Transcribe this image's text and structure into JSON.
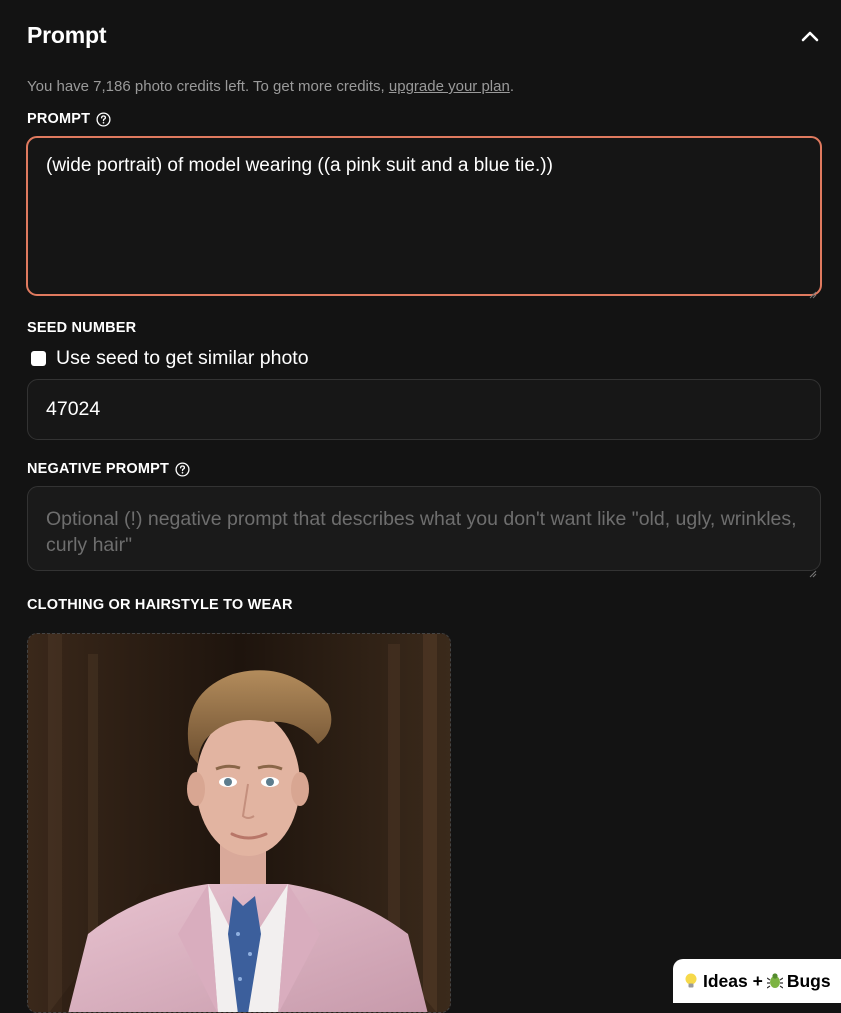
{
  "panel": {
    "title": "Prompt"
  },
  "credits": {
    "text": "You have 7,186 photo credits left. To get more credits, ",
    "link": "upgrade your plan",
    "suffix": "."
  },
  "prompt": {
    "label": "PROMPT",
    "value": "(wide portrait) of model wearing ((a pink suit and a blue tie.))"
  },
  "seed": {
    "label": "SEED NUMBER",
    "checkbox_label": "Use seed to get similar photo",
    "checked": false,
    "value": "47024"
  },
  "negative_prompt": {
    "label": "NEGATIVE PROMPT",
    "placeholder": "Optional (!) negative prompt that describes what you don't want like \"old, ugly, wrinkles, curly hair\""
  },
  "clothing": {
    "label": "CLOTHING OR HAIRSTYLE TO WEAR"
  },
  "feedback": {
    "ideas": "Ideas +",
    "bugs": "Bugs"
  },
  "colors": {
    "background": "#131313",
    "accent_border": "#e07a5f",
    "muted_text": "#9a9a9a",
    "placeholder_text": "#6e6e6e"
  },
  "icons": {
    "collapse": "chevron-up-icon",
    "help": "question-circle-icon",
    "ideas": "lightbulb-icon",
    "bugs": "bug-icon"
  }
}
